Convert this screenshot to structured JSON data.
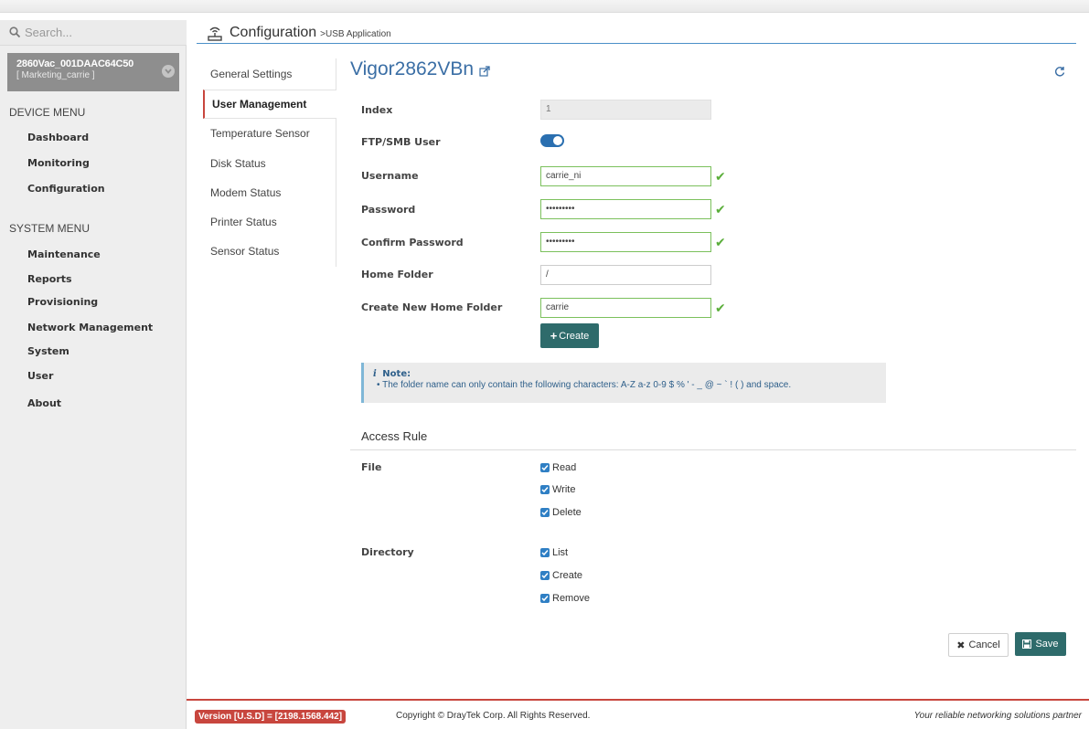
{
  "sidebar": {
    "search_placeholder": "Search...",
    "device_name": "2860Vac_001DAAC64C50",
    "device_group": "[ Marketing_carrie ]",
    "device_menu_title": "DEVICE MENU",
    "device_menu": [
      "Dashboard",
      "Monitoring",
      "Configuration"
    ],
    "system_menu_title": "SYSTEM MENU",
    "system_menu": [
      "Maintenance",
      "Reports",
      "Provisioning",
      "Network Management",
      "System",
      "User",
      "About"
    ]
  },
  "header": {
    "title": "Configuration",
    "breadcrumb": ">USB Application"
  },
  "subnav": {
    "items": [
      "General Settings",
      "User Management",
      "Temperature Sensor",
      "Disk Status",
      "Modem Status",
      "Printer Status",
      "Sensor Status"
    ],
    "active": "User Management"
  },
  "main": {
    "device_title": "Vigor2862VBn",
    "fields": {
      "index_label": "Index",
      "index_value": "1",
      "ftp_label": "FTP/SMB User",
      "ftp_enabled": true,
      "username_label": "Username",
      "username_value": "carrie_ni",
      "password_label": "Password",
      "password_value": "•••••••••",
      "confirm_label": "Confirm Password",
      "confirm_value": "•••••••••",
      "home_label": "Home Folder",
      "home_value": "/",
      "new_home_label": "Create New Home Folder",
      "new_home_value": "carrie"
    },
    "create_button": "Create",
    "note": {
      "title": "Note:",
      "body": "The folder name can only contain the following characters: A-Z a-z 0-9 $ % ' - _ @ ~ ` ! ( ) and space."
    },
    "access_rule": {
      "title": "Access Rule",
      "file_label": "File",
      "file_options": [
        "Read",
        "Write",
        "Delete"
      ],
      "directory_label": "Directory",
      "directory_options": [
        "List",
        "Create",
        "Remove"
      ]
    },
    "cancel_button": "Cancel",
    "save_button": "Save"
  },
  "footer": {
    "version": "Version [U.S.D] = [2198.1568.442]",
    "copyright": "Copyright © DrayTek Corp. All Rights Reserved.",
    "tagline": "Your reliable networking solutions partner"
  },
  "colors": {
    "accent_red": "#c8463e",
    "primary_teal": "#2e6b6b",
    "link_blue": "#3a6ea5",
    "toggle_blue": "#2a6fb0",
    "check_green": "#5aae3a"
  }
}
